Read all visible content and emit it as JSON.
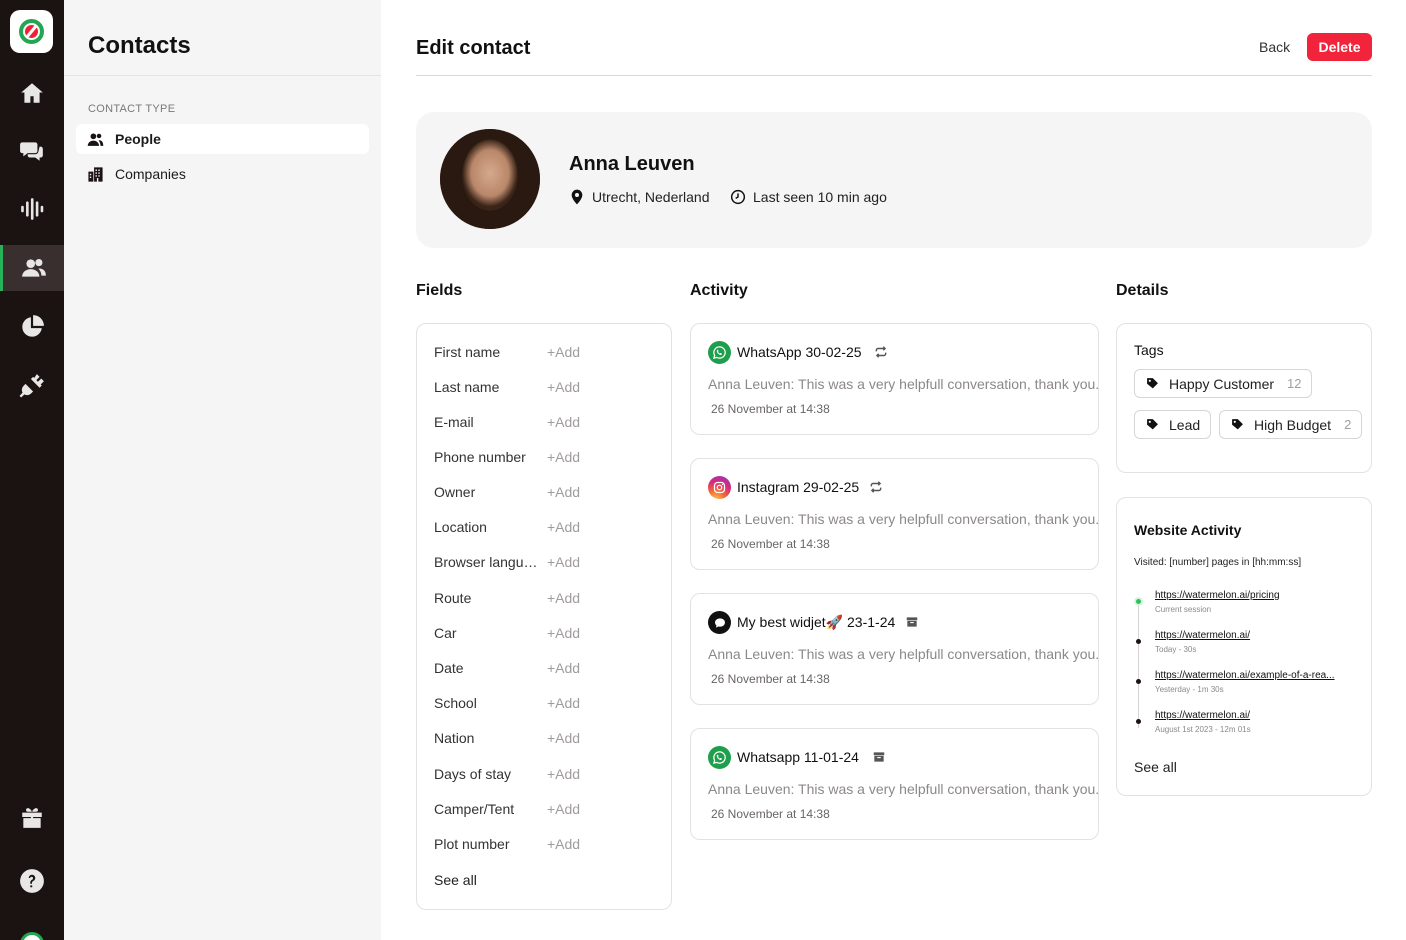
{
  "sidebar": {
    "title": "Contacts",
    "section_label": "CONTACT TYPE",
    "items": [
      {
        "label": "People",
        "icon": "people-icon",
        "active": true
      },
      {
        "label": "Companies",
        "icon": "building-icon",
        "active": false
      }
    ]
  },
  "rail": {
    "items": [
      "home-icon",
      "chat-icon",
      "audio-wave-icon",
      "contacts-icon",
      "pie-chart-icon",
      "plug-icon",
      "gift-icon",
      "help-icon"
    ],
    "active": "contacts-icon"
  },
  "header": {
    "title": "Edit contact",
    "back_label": "Back",
    "delete_label": "Delete"
  },
  "profile": {
    "name": "Anna Leuven",
    "location": "Utrecht, Nederland",
    "last_seen": "Last seen 10 min ago"
  },
  "fields": {
    "heading": "Fields",
    "add_label": "+Add",
    "see_all": "See all",
    "rows": [
      "First name",
      "Last name",
      "E-mail",
      "Phone number",
      "Owner",
      "Location",
      "Browser langua...",
      "Route",
      "Car",
      "Date",
      "School",
      "Nation",
      "Days of stay",
      "Camper/Tent",
      "Plot number"
    ]
  },
  "activity": {
    "heading": "Activity",
    "items": [
      {
        "channel_icon": "whatsapp-icon",
        "title": "WhatsApp 30-02-25",
        "status_icon": "repeat-icon",
        "message": "Anna Leuven: This was a very helpfull conversation, thank you.",
        "time": "26 November at 14:38"
      },
      {
        "channel_icon": "instagram-icon",
        "title": "Instagram 29-02-25",
        "status_icon": "repeat-icon",
        "message": "Anna Leuven: This was a very helpfull conversation, thank you.",
        "time": "26 November at 14:38"
      },
      {
        "channel_icon": "widget-chat-icon",
        "title": "My best widjet🚀 23-1-24",
        "status_icon": "archive-icon",
        "message": "Anna Leuven: This was a very helpfull conversation, thank you.",
        "time": "26 November at 14:38"
      },
      {
        "channel_icon": "whatsapp-icon",
        "title": "Whatsapp 11-01-24",
        "status_icon": "archive-icon",
        "message": "Anna Leuven: This was a very helpfull conversation, thank you.",
        "time": "26 November at 14:38"
      }
    ]
  },
  "details": {
    "heading": "Details",
    "tags_title": "Tags",
    "tags": [
      {
        "label": "Happy Customer",
        "count": "12"
      },
      {
        "label": "Lead",
        "count": ""
      },
      {
        "label": "High Budget",
        "count": "2"
      }
    ],
    "website": {
      "title": "Website Activity",
      "subtitle": "Visited: [number] pages in [hh:mm:ss]",
      "visits": [
        {
          "url": "https://watermelon.ai/pricing",
          "meta": "Current session",
          "current": true
        },
        {
          "url": "https://watermelon.ai/",
          "meta": "Today - 30s",
          "current": false
        },
        {
          "url": "https://watermelon.ai/example-of-a-rea...",
          "meta": "Yesterday - 1m 30s",
          "current": false
        },
        {
          "url": "https://watermelon.ai/",
          "meta": "August 1st 2023 - 12m 01s",
          "current": false
        }
      ],
      "see_all": "See all"
    }
  },
  "colors": {
    "accent_green": "#22a650",
    "delete_red": "#f1243b",
    "rail_bg": "#1b1212",
    "whatsapp": "#1e9f4b"
  }
}
